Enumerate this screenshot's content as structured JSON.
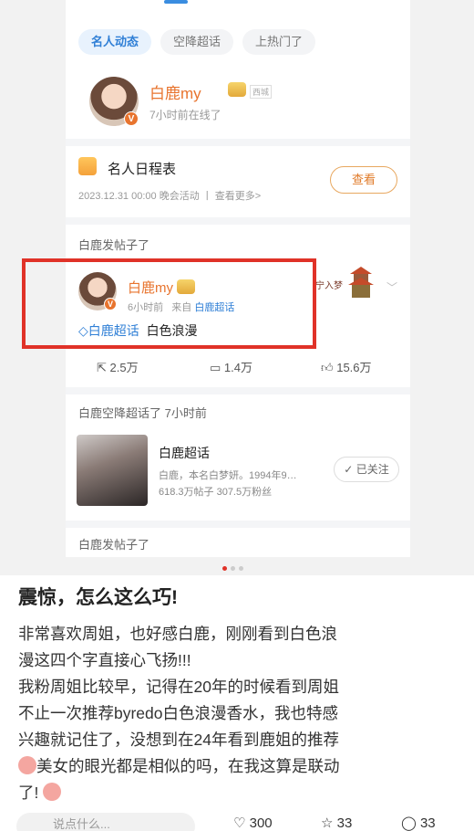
{
  "tabs": [
    "名人动态",
    "空降超话",
    "上热门了"
  ],
  "user": {
    "name": "白鹿my",
    "status": "7小时前在线了",
    "tag": "西城"
  },
  "schedule": {
    "title": "名人日程表",
    "sub": "2023.12.31 00:00 晚会活动 丨 查看更多>",
    "button": "查看"
  },
  "sections": {
    "posted1": "白鹿发帖子了",
    "airdrop": "白鹿空降超话了 7小时前",
    "posted2": "白鹿发帖子了"
  },
  "post": {
    "name": "白鹿my",
    "time": "6小时前",
    "from_label": "来自",
    "from_link": "白鹿超话",
    "topic": "白鹿超话",
    "text": "白色浪漫",
    "thumb_text": "宁入梦"
  },
  "actions": {
    "share": "2.5万",
    "comment": "1.4万",
    "like": "15.6万"
  },
  "topic_card": {
    "name": "白鹿超话",
    "desc": "白鹿，本名白梦妍。1994年9…",
    "stats": "618.3万帖子  307.5万粉丝",
    "follow": "已关注"
  },
  "note": {
    "title": "震惊，怎么这么巧!",
    "body": [
      "非常喜欢周姐，也好感白鹿，刚刚看到白色浪",
      "漫这四个字直接心飞扬!!!",
      "我粉周姐比较早，记得在20年的时候看到周姐",
      "不止一次推荐byredo白色浪漫香水，我也特感",
      "兴趣就记住了，没想到在24年看到鹿姐的推荐",
      "美女的眼光都是相似的吗，在我这算是联动",
      "了!"
    ]
  },
  "bottom": {
    "comment_placeholder": "说点什么...",
    "likes": "300",
    "stars": "33",
    "comments": "33"
  },
  "colors": {
    "accent_orange": "#e8742e",
    "link_blue": "#2f7fd6",
    "highlight_red": "#e03228"
  }
}
